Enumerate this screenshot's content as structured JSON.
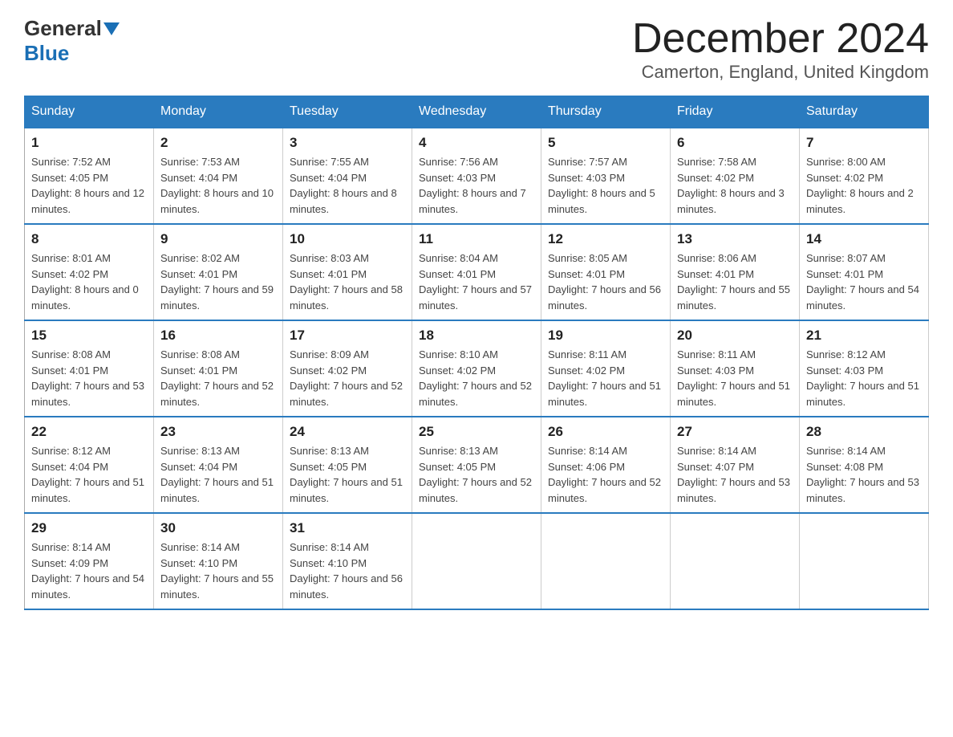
{
  "header": {
    "logo": {
      "general": "General",
      "blue": "Blue"
    },
    "title": "December 2024",
    "location": "Camerton, England, United Kingdom"
  },
  "days_of_week": [
    "Sunday",
    "Monday",
    "Tuesday",
    "Wednesday",
    "Thursday",
    "Friday",
    "Saturday"
  ],
  "weeks": [
    [
      {
        "day": "1",
        "sunrise": "7:52 AM",
        "sunset": "4:05 PM",
        "daylight": "8 hours and 12 minutes."
      },
      {
        "day": "2",
        "sunrise": "7:53 AM",
        "sunset": "4:04 PM",
        "daylight": "8 hours and 10 minutes."
      },
      {
        "day": "3",
        "sunrise": "7:55 AM",
        "sunset": "4:04 PM",
        "daylight": "8 hours and 8 minutes."
      },
      {
        "day": "4",
        "sunrise": "7:56 AM",
        "sunset": "4:03 PM",
        "daylight": "8 hours and 7 minutes."
      },
      {
        "day": "5",
        "sunrise": "7:57 AM",
        "sunset": "4:03 PM",
        "daylight": "8 hours and 5 minutes."
      },
      {
        "day": "6",
        "sunrise": "7:58 AM",
        "sunset": "4:02 PM",
        "daylight": "8 hours and 3 minutes."
      },
      {
        "day": "7",
        "sunrise": "8:00 AM",
        "sunset": "4:02 PM",
        "daylight": "8 hours and 2 minutes."
      }
    ],
    [
      {
        "day": "8",
        "sunrise": "8:01 AM",
        "sunset": "4:02 PM",
        "daylight": "8 hours and 0 minutes."
      },
      {
        "day": "9",
        "sunrise": "8:02 AM",
        "sunset": "4:01 PM",
        "daylight": "7 hours and 59 minutes."
      },
      {
        "day": "10",
        "sunrise": "8:03 AM",
        "sunset": "4:01 PM",
        "daylight": "7 hours and 58 minutes."
      },
      {
        "day": "11",
        "sunrise": "8:04 AM",
        "sunset": "4:01 PM",
        "daylight": "7 hours and 57 minutes."
      },
      {
        "day": "12",
        "sunrise": "8:05 AM",
        "sunset": "4:01 PM",
        "daylight": "7 hours and 56 minutes."
      },
      {
        "day": "13",
        "sunrise": "8:06 AM",
        "sunset": "4:01 PM",
        "daylight": "7 hours and 55 minutes."
      },
      {
        "day": "14",
        "sunrise": "8:07 AM",
        "sunset": "4:01 PM",
        "daylight": "7 hours and 54 minutes."
      }
    ],
    [
      {
        "day": "15",
        "sunrise": "8:08 AM",
        "sunset": "4:01 PM",
        "daylight": "7 hours and 53 minutes."
      },
      {
        "day": "16",
        "sunrise": "8:08 AM",
        "sunset": "4:01 PM",
        "daylight": "7 hours and 52 minutes."
      },
      {
        "day": "17",
        "sunrise": "8:09 AM",
        "sunset": "4:02 PM",
        "daylight": "7 hours and 52 minutes."
      },
      {
        "day": "18",
        "sunrise": "8:10 AM",
        "sunset": "4:02 PM",
        "daylight": "7 hours and 52 minutes."
      },
      {
        "day": "19",
        "sunrise": "8:11 AM",
        "sunset": "4:02 PM",
        "daylight": "7 hours and 51 minutes."
      },
      {
        "day": "20",
        "sunrise": "8:11 AM",
        "sunset": "4:03 PM",
        "daylight": "7 hours and 51 minutes."
      },
      {
        "day": "21",
        "sunrise": "8:12 AM",
        "sunset": "4:03 PM",
        "daylight": "7 hours and 51 minutes."
      }
    ],
    [
      {
        "day": "22",
        "sunrise": "8:12 AM",
        "sunset": "4:04 PM",
        "daylight": "7 hours and 51 minutes."
      },
      {
        "day": "23",
        "sunrise": "8:13 AM",
        "sunset": "4:04 PM",
        "daylight": "7 hours and 51 minutes."
      },
      {
        "day": "24",
        "sunrise": "8:13 AM",
        "sunset": "4:05 PM",
        "daylight": "7 hours and 51 minutes."
      },
      {
        "day": "25",
        "sunrise": "8:13 AM",
        "sunset": "4:05 PM",
        "daylight": "7 hours and 52 minutes."
      },
      {
        "day": "26",
        "sunrise": "8:14 AM",
        "sunset": "4:06 PM",
        "daylight": "7 hours and 52 minutes."
      },
      {
        "day": "27",
        "sunrise": "8:14 AM",
        "sunset": "4:07 PM",
        "daylight": "7 hours and 53 minutes."
      },
      {
        "day": "28",
        "sunrise": "8:14 AM",
        "sunset": "4:08 PM",
        "daylight": "7 hours and 53 minutes."
      }
    ],
    [
      {
        "day": "29",
        "sunrise": "8:14 AM",
        "sunset": "4:09 PM",
        "daylight": "7 hours and 54 minutes."
      },
      {
        "day": "30",
        "sunrise": "8:14 AM",
        "sunset": "4:10 PM",
        "daylight": "7 hours and 55 minutes."
      },
      {
        "day": "31",
        "sunrise": "8:14 AM",
        "sunset": "4:10 PM",
        "daylight": "7 hours and 56 minutes."
      },
      null,
      null,
      null,
      null
    ]
  ]
}
